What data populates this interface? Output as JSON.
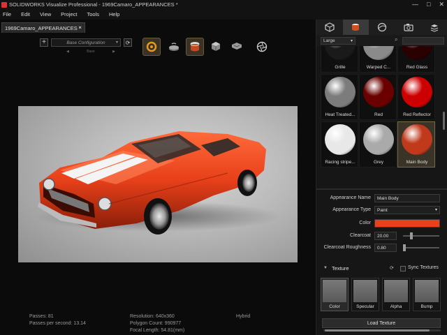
{
  "window": {
    "title": "SOLIDWORKS Visualize Professional - 1969Camaro_APPEARANCES *",
    "controls": [
      "—",
      "□",
      "✕"
    ]
  },
  "menu": [
    "File",
    "Edit",
    "View",
    "Project",
    "Tools",
    "Help"
  ],
  "document_tab": {
    "label": "1969Camaro_APPEARANCES *",
    "close": "×"
  },
  "toolbar": {
    "add": "+",
    "configuration": "Base Configuration",
    "configuration_sub": "Base",
    "icons": [
      "ring-icon",
      "turntable-icon",
      "paint-bucket-icon",
      "cube-icon",
      "tray-icon",
      "aperture-icon"
    ]
  },
  "stats": {
    "passes": "Passes: 81",
    "passes_per_second": "Passes per second: 13.14",
    "resolution": "Resolution: 640x360",
    "polygon_count": "Polygon Count: 990977",
    "focal_length": "Focal Length: 54.81(mm)",
    "mode": "Hybrid"
  },
  "panel": {
    "tabs": [
      "model-icon",
      "appearance-icon",
      "scene-icon",
      "camera-icon",
      "libraries-icon"
    ],
    "size": "Large",
    "swatches": [
      {
        "label": "Grille",
        "color": "#1a1a1a"
      },
      {
        "label": "Warped C...",
        "color": "#8a8a8a"
      },
      {
        "label": "Red Glass",
        "color": "#2a0000"
      },
      {
        "label": "Heat Treated...",
        "color": "#7c7c7c"
      },
      {
        "label": "Red",
        "color": "#6a0000"
      },
      {
        "label": "Red Reflector",
        "color": "#cc0000"
      },
      {
        "label": "Racing stripe...",
        "color": "#e8e8e8"
      },
      {
        "label": "Grey",
        "color": "#aaaaaa"
      },
      {
        "label": "Main Body",
        "color": "#c0391b"
      }
    ],
    "properties": {
      "appearance_name_label": "Appearance Name",
      "appearance_name": "Main Body",
      "appearance_type_label": "Appearance Type",
      "appearance_type": "Paint",
      "color_label": "Color",
      "color": "#e8401a",
      "clearcoat_label": "Clearcoat",
      "clearcoat": "20.00",
      "roughness_label": "Clearcoat Roughness",
      "roughness": "0.80"
    },
    "texture": {
      "title": "Texture",
      "sync": "Sync Textures",
      "slots": [
        "Color",
        "Specular",
        "Alpha",
        "Bump"
      ],
      "load_button": "Load Texture"
    }
  }
}
